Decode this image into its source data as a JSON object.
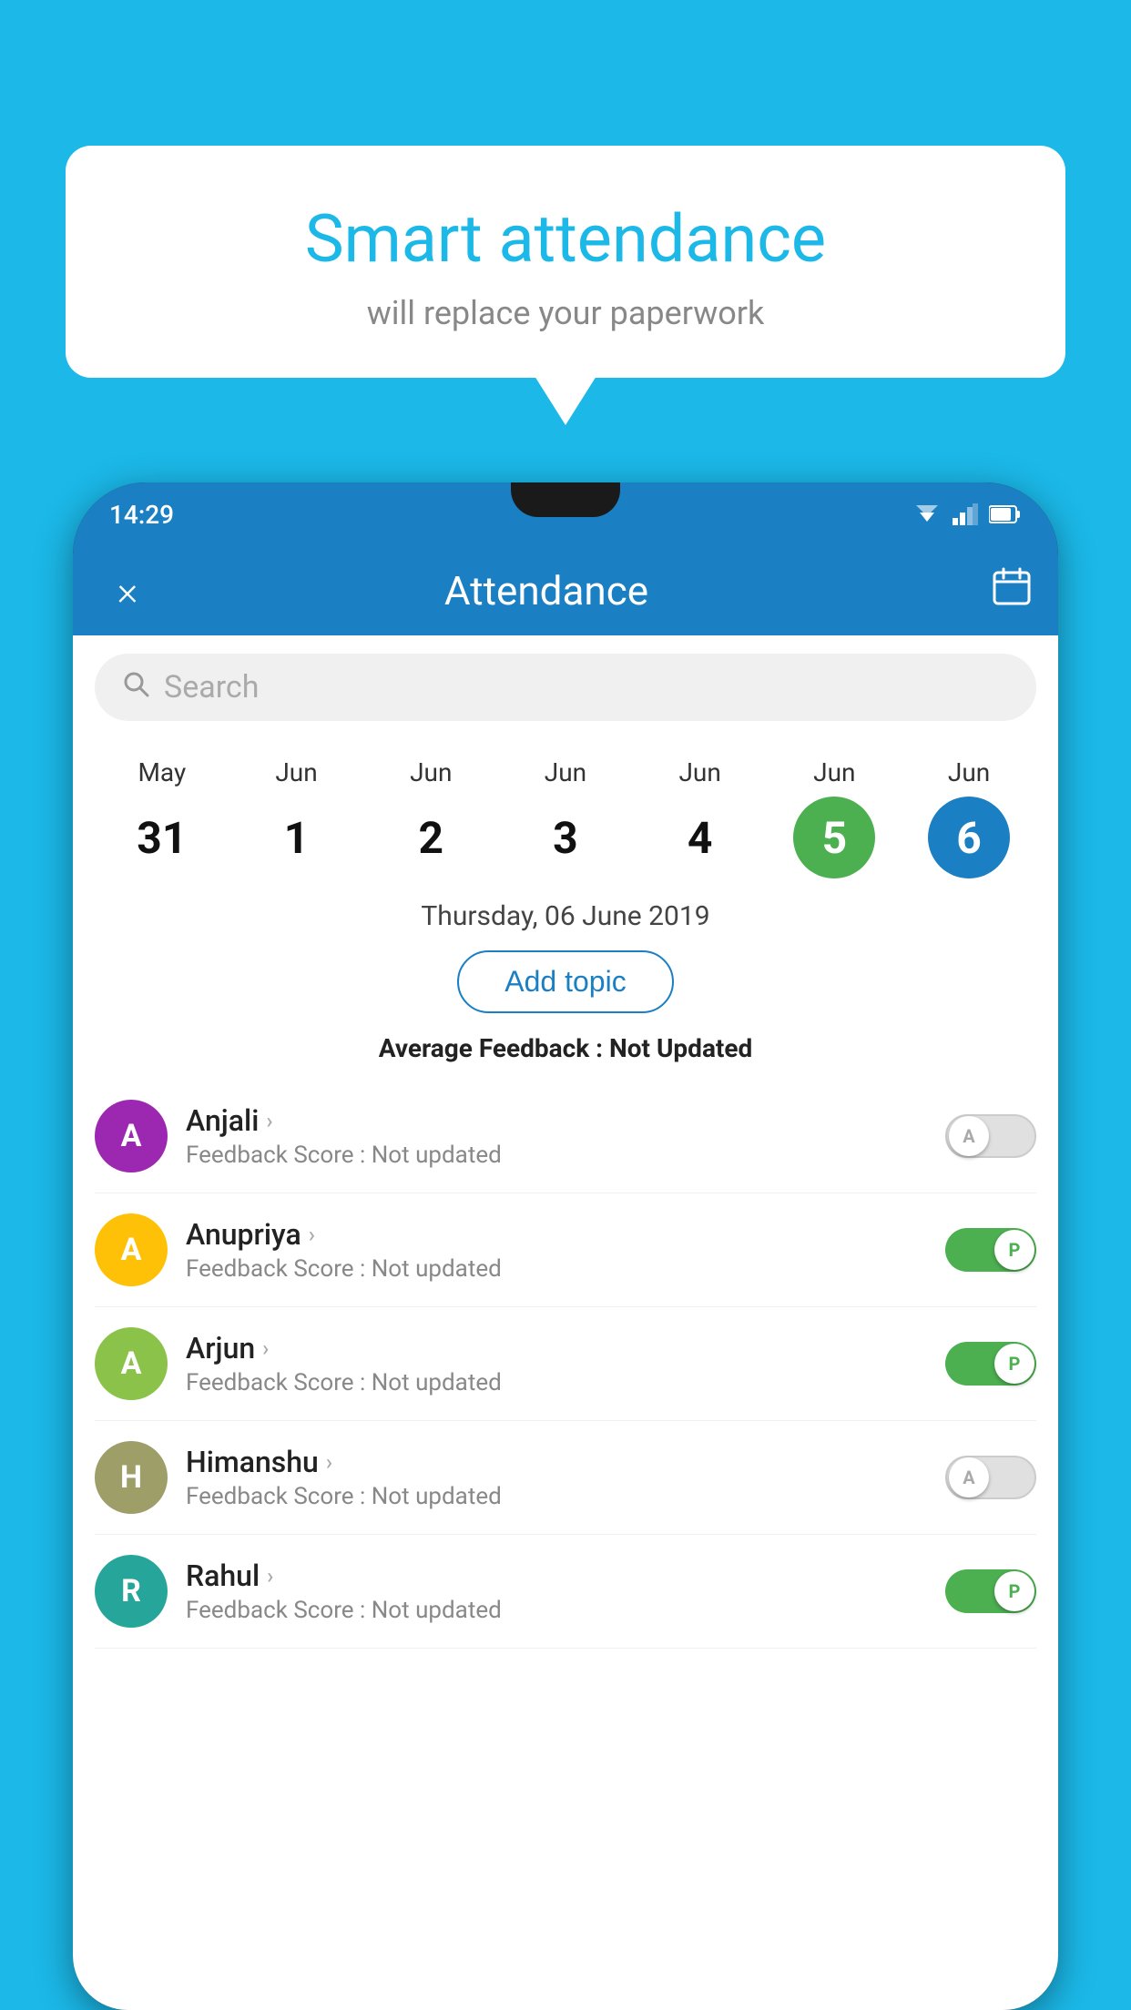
{
  "background_color": "#1BB8E8",
  "bubble": {
    "title": "Smart attendance",
    "subtitle": "will replace your paperwork"
  },
  "status_bar": {
    "time": "14:29"
  },
  "app_bar": {
    "title": "Attendance",
    "close_label": "×",
    "calendar_icon": "📅"
  },
  "search": {
    "placeholder": "Search"
  },
  "calendar": {
    "days": [
      {
        "month": "May",
        "date": "31",
        "style": "normal"
      },
      {
        "month": "Jun",
        "date": "1",
        "style": "normal"
      },
      {
        "month": "Jun",
        "date": "2",
        "style": "normal"
      },
      {
        "month": "Jun",
        "date": "3",
        "style": "normal"
      },
      {
        "month": "Jun",
        "date": "4",
        "style": "normal"
      },
      {
        "month": "Jun",
        "date": "5",
        "style": "green"
      },
      {
        "month": "Jun",
        "date": "6",
        "style": "blue"
      }
    ]
  },
  "selected_date_label": "Thursday, 06 June 2019",
  "add_topic_label": "Add topic",
  "avg_feedback_label": "Average Feedback :",
  "avg_feedback_value": "Not Updated",
  "students": [
    {
      "name": "Anjali",
      "avatar_letter": "A",
      "avatar_color": "purple",
      "feedback": "Feedback Score : Not updated",
      "toggle": "off",
      "toggle_letter": "A"
    },
    {
      "name": "Anupriya",
      "avatar_letter": "A",
      "avatar_color": "yellow",
      "feedback": "Feedback Score : Not updated",
      "toggle": "on",
      "toggle_letter": "P"
    },
    {
      "name": "Arjun",
      "avatar_letter": "A",
      "avatar_color": "light-green",
      "feedback": "Feedback Score : Not updated",
      "toggle": "on",
      "toggle_letter": "P"
    },
    {
      "name": "Himanshu",
      "avatar_letter": "H",
      "avatar_color": "olive",
      "feedback": "Feedback Score : Not updated",
      "toggle": "off",
      "toggle_letter": "A"
    },
    {
      "name": "Rahul",
      "avatar_letter": "R",
      "avatar_color": "teal",
      "feedback": "Feedback Score : Not updated",
      "toggle": "on",
      "toggle_letter": "P"
    }
  ]
}
